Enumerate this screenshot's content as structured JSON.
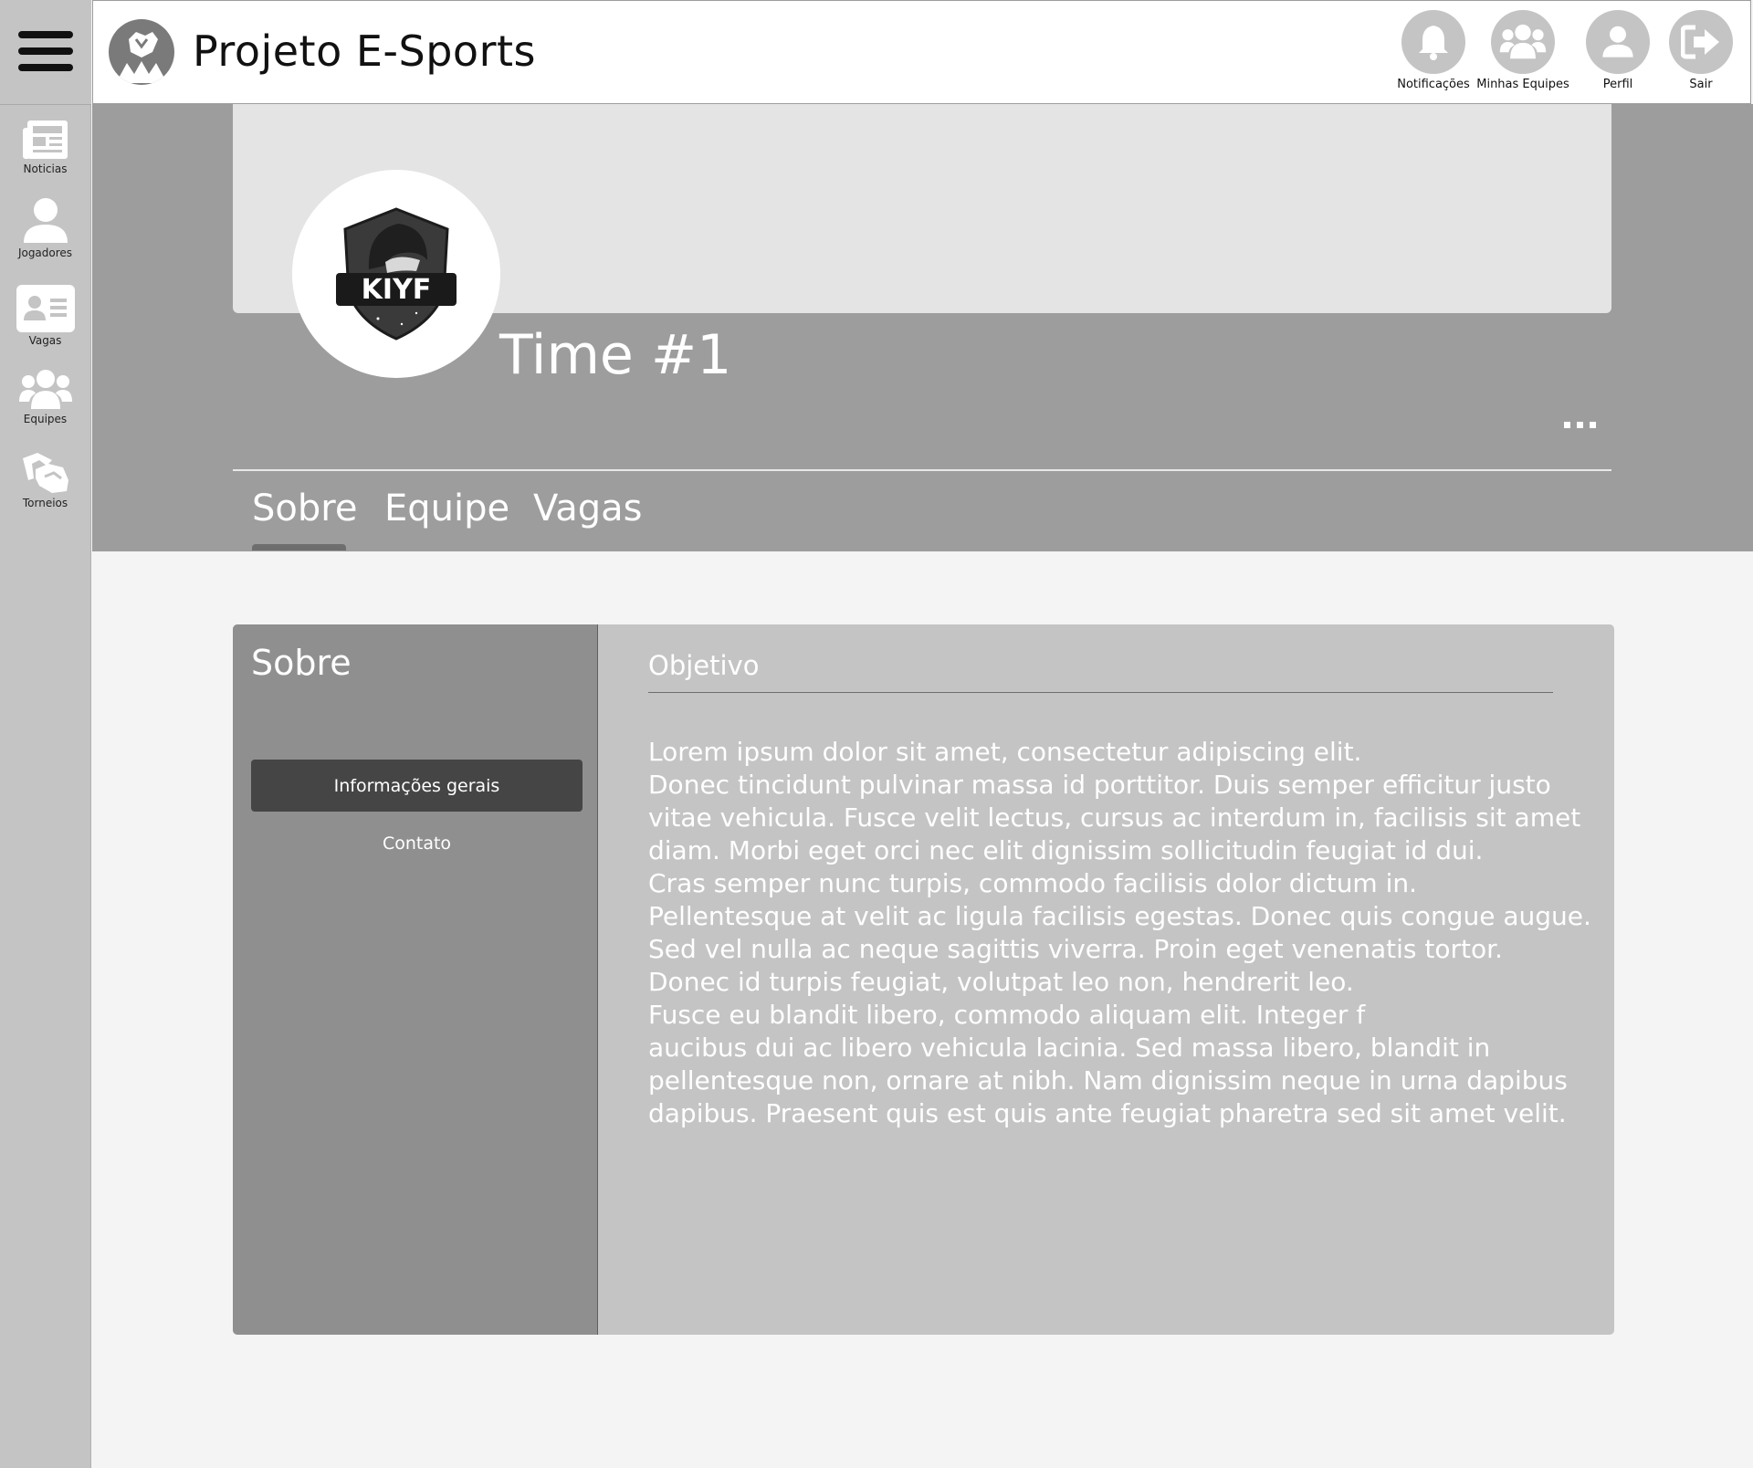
{
  "app": {
    "title": "Projeto E-Sports"
  },
  "header": {
    "actions": [
      {
        "label": "Notificações",
        "icon": "bell-icon"
      },
      {
        "label": "Minhas Equipes",
        "icon": "users-icon"
      },
      {
        "label": "Perfil",
        "icon": "user-icon"
      },
      {
        "label": "Sair",
        "icon": "sign-out-icon"
      }
    ]
  },
  "sidebar": {
    "items": [
      {
        "label": "Noticias",
        "icon": "newspaper-icon"
      },
      {
        "label": "Jogadores",
        "icon": "user-icon"
      },
      {
        "label": "Vagas",
        "icon": "id-card-icon"
      },
      {
        "label": "Equipes",
        "icon": "users-icon"
      },
      {
        "label": "Torneios",
        "icon": "handshake-icon"
      }
    ]
  },
  "team": {
    "name": "Time #1",
    "logo_text": "KIYF",
    "more": "..."
  },
  "tabs": [
    {
      "label": "Sobre",
      "active": true
    },
    {
      "label": "Equipe",
      "active": false
    },
    {
      "label": "Vagas",
      "active": false
    }
  ],
  "about": {
    "title": "Sobre",
    "menu": [
      {
        "label": "Informações gerais",
        "active": true
      },
      {
        "label": "Contato",
        "active": false
      }
    ],
    "section_title": "Objetivo",
    "lines": [
      "Lorem ipsum dolor sit amet, consectetur adipiscing elit.",
      "Donec tincidunt pulvinar massa id porttitor. Duis semper efficitur justo",
      "vitae vehicula. Fusce velit lectus, cursus ac interdum in, facilisis sit amet",
      "diam. Morbi eget orci nec elit dignissim sollicitudin feugiat id dui.",
      "Cras semper nunc turpis, commodo facilisis dolor dictum in.",
      "Pellentesque at velit ac ligula facilisis egestas. Donec quis congue augue.",
      "Sed vel nulla ac neque sagittis viverra. Proin eget venenatis tortor.",
      "Donec id turpis feugiat, volutpat leo non, hendrerit leo.",
      "Fusce eu blandit libero, commodo aliquam elit. Integer f",
      "aucibus dui ac libero vehicula lacinia. Sed massa libero, blandit in",
      "pellentesque non, ornare at nibh. Nam dignissim neque in urna dapibus",
      "dapibus. Praesent quis est quis ante feugiat pharetra sed sit amet velit."
    ]
  },
  "colors": {
    "sidebar": "#c4c4c4",
    "band": "#9d9d9d",
    "cover": "#e4e4e4",
    "card": "#c4c4c4",
    "card_left": "#8f8f8f",
    "active_menu": "#454545",
    "page_bg": "#f4f4f4"
  }
}
